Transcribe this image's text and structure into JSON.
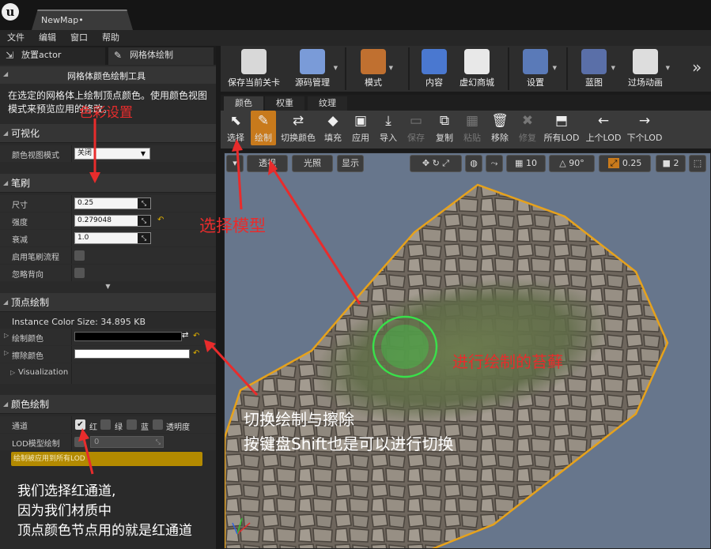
{
  "window": {
    "tab_title": "NewMap•",
    "logo_glyph": "u"
  },
  "menu": [
    "文件",
    "编辑",
    "窗口",
    "帮助"
  ],
  "left_tabs": [
    {
      "label": "放置actor",
      "icon": "place-actor-icon"
    },
    {
      "label": "网格体绘制",
      "icon": "brush-icon"
    }
  ],
  "tool_header": "网格体颜色绘制工具",
  "description": "在选定的网格体上绘制顶点颜色。使用颜色视图模式来预览应用的修改。",
  "sections": {
    "visualize": {
      "title": "可视化",
      "rows": [
        {
          "label": "颜色视图模式",
          "value": "关闭"
        }
      ]
    },
    "brush": {
      "title": "笔刷",
      "size": {
        "label": "尺寸",
        "value": "0.25"
      },
      "strength": {
        "label": "强度",
        "value": "0.279048"
      },
      "falloff": {
        "label": "衰减",
        "value": "1.0"
      },
      "flow": {
        "label": "启用笔刷流程"
      },
      "ignore_back": {
        "label": "忽略背向"
      }
    },
    "vertex_paint": {
      "title": "顶点绘制",
      "instance_size": "Instance Color Size: 34.895 KB",
      "paint_color_label": "绘制颜色",
      "erase_color_label": "擦除颜色",
      "paint_color": "#000000",
      "erase_color": "#ffffff",
      "visualization": "Visualization"
    },
    "color_paint": {
      "title": "颜色绘制",
      "channels_label": "通道",
      "channels": [
        {
          "name": "红",
          "checked": true
        },
        {
          "name": "绿",
          "checked": false
        },
        {
          "name": "蓝",
          "checked": false
        },
        {
          "name": "透明度",
          "checked": false
        }
      ],
      "lod_label": "LOD模型绘制",
      "lod_value": "0",
      "apply_all_lod": "绘制被应用到所有LOD"
    }
  },
  "toolbar": [
    {
      "label": "保存当前关卡",
      "icon": "save-icon",
      "color": "#d8d8d8"
    },
    {
      "label": "源码管理",
      "icon": "source-control-icon",
      "color": "#7a9bd8"
    },
    {
      "label": "模式",
      "icon": "modes-icon",
      "color": "#c07030"
    },
    {
      "label": "内容",
      "icon": "content-icon",
      "color": "#4a78d0"
    },
    {
      "label": "虚幻商城",
      "icon": "marketplace-icon",
      "color": "#e8e8e8"
    },
    {
      "label": "设置",
      "icon": "settings-icon",
      "color": "#5a7ab8"
    },
    {
      "label": "蓝图",
      "icon": "blueprint-icon",
      "color": "#5a6fa8"
    },
    {
      "label": "过场动画",
      "icon": "cinematics-icon",
      "color": "#dddddd"
    }
  ],
  "mode_tabs": [
    "颜色",
    "权重",
    "纹理"
  ],
  "mode_tools": [
    {
      "label": "选择",
      "glyph": "⬉",
      "icon": "select-icon",
      "enabled": true
    },
    {
      "label": "绘制",
      "glyph": "✎",
      "icon": "paint-brush-icon",
      "enabled": true,
      "active": true
    },
    {
      "label": "切换颜色",
      "glyph": "⇄",
      "icon": "swap-color-icon",
      "enabled": true
    },
    {
      "label": "填充",
      "glyph": "◆",
      "icon": "fill-icon",
      "enabled": true
    },
    {
      "label": "应用",
      "glyph": "▣",
      "icon": "apply-icon",
      "enabled": true
    },
    {
      "label": "导入",
      "glyph": "⤓",
      "icon": "import-icon",
      "enabled": true
    },
    {
      "label": "保存",
      "glyph": "▭",
      "icon": "save-tool-icon",
      "enabled": false
    },
    {
      "label": "复制",
      "glyph": "⧉",
      "icon": "copy-icon",
      "enabled": true
    },
    {
      "label": "粘贴",
      "glyph": "▦",
      "icon": "paste-icon",
      "enabled": false
    },
    {
      "label": "移除",
      "glyph": "🗑",
      "icon": "remove-icon",
      "enabled": true
    },
    {
      "label": "修复",
      "glyph": "✖",
      "icon": "fix-icon",
      "enabled": false
    },
    {
      "label": "所有LOD",
      "glyph": "⬒",
      "icon": "all-lod-icon",
      "enabled": true
    },
    {
      "label": "上个LOD",
      "glyph": "←",
      "icon": "prev-lod-icon",
      "enabled": true
    },
    {
      "label": "下个LOD",
      "glyph": "→",
      "icon": "next-lod-icon",
      "enabled": true
    }
  ],
  "viewport_bar": {
    "perspective": "透视",
    "lit": "光照",
    "show": "显示",
    "grid_snap": "10",
    "angle_snap": "90°",
    "scale_snap": "0.25",
    "camera_speed": "2"
  },
  "annotations": {
    "color_settings": "色彩设置",
    "select_model": "选择模型",
    "painting_moss": "进行绘制的苔藓",
    "toggle_line1": "切换绘制与擦除",
    "toggle_line2": "按键盘Shift也是可以进行切换",
    "red_line1": "我们选择红通道,",
    "red_line2": "因为我们材质中",
    "red_line3": "顶点颜色节点用的就是红通道",
    "red_color": "#e82c2c"
  }
}
